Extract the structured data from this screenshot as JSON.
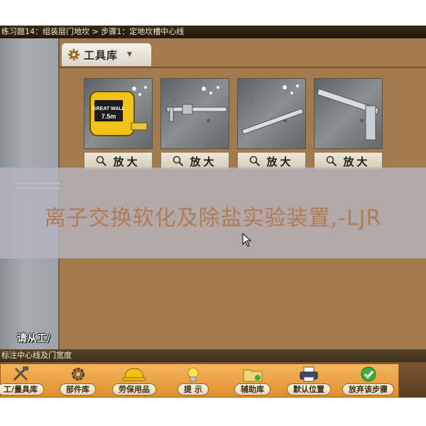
{
  "window": {
    "title": "练习题14：组装层门地坎 > 步骤1：定地坎槽中心线"
  },
  "left_pane": {
    "hint": "请从工/"
  },
  "toolbox": {
    "tab_label": "工具库",
    "tools": [
      {
        "name": "tape-measure",
        "zoom_label": "放大",
        "tape_brand": "GREAT WALL",
        "tape_size": "7.5m"
      },
      {
        "name": "caliper",
        "zoom_label": "放大"
      },
      {
        "name": "ruler",
        "zoom_label": "放大"
      },
      {
        "name": "square-ruler",
        "zoom_label": "放大"
      }
    ]
  },
  "watermark": {
    "text": "离子交换软化及除盐实验装置,-LJR"
  },
  "status": {
    "text": "标注中心线及门宽度"
  },
  "bottom_toolbar": {
    "buttons": [
      {
        "label": "工/量具库",
        "icon": "tools-icon"
      },
      {
        "label": "部件库",
        "icon": "gear-icon"
      },
      {
        "label": "劳保用品",
        "icon": "hardhat-icon"
      },
      {
        "label": "提 示",
        "icon": "lightbulb-icon"
      },
      {
        "label": "辅助库",
        "icon": "folder-icon"
      },
      {
        "label": "默认位置",
        "icon": "printer-icon"
      },
      {
        "label": "放弃该步骤",
        "icon": "checkmark-icon"
      }
    ]
  },
  "colors": {
    "panel_brown": "#a37a4b",
    "toolbar_orange": "#e08e2c",
    "watermark_text": "#b07d52"
  }
}
